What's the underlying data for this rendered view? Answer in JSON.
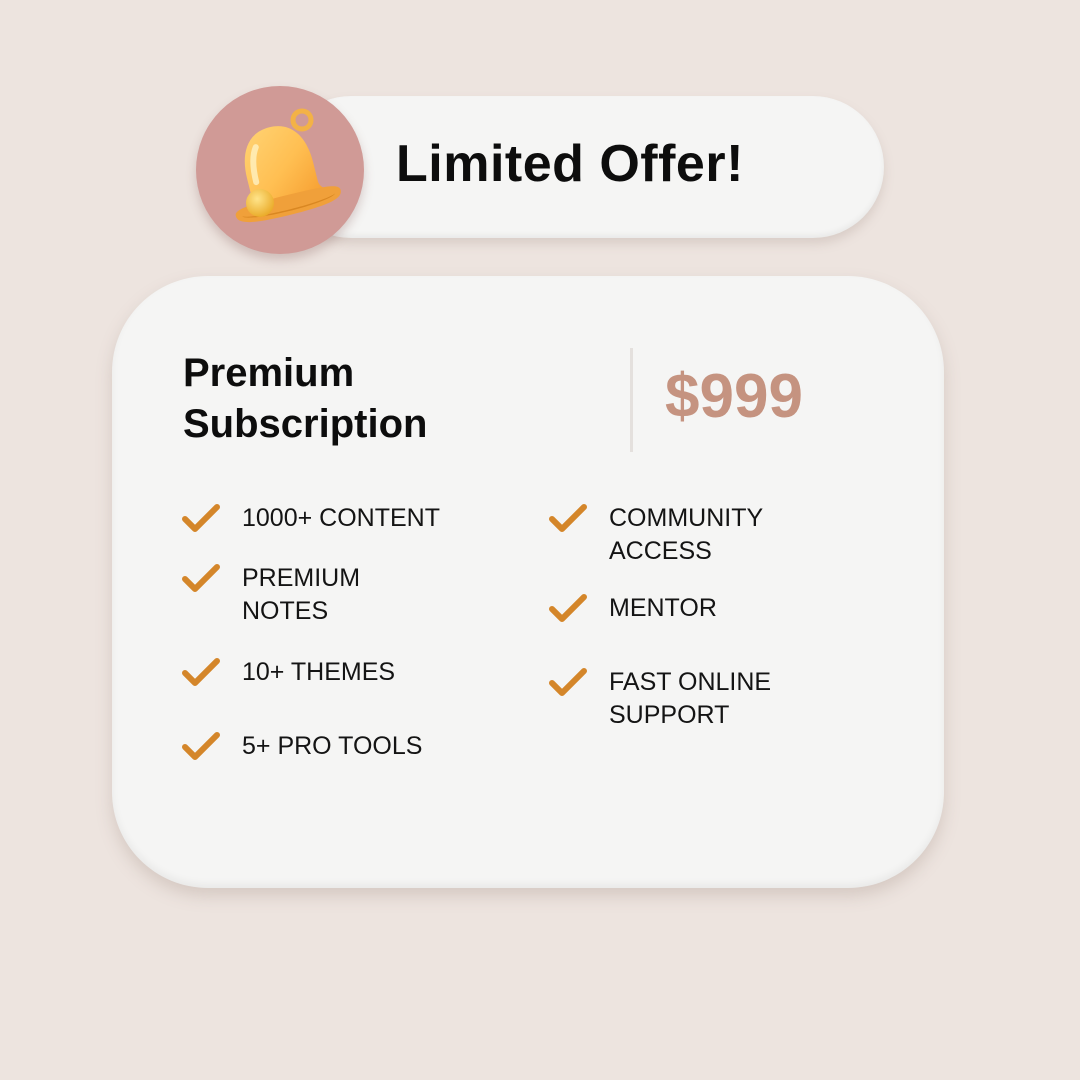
{
  "banner": {
    "title": "Limited Offer!"
  },
  "plan": {
    "name": "Premium Subscription",
    "price": "$999"
  },
  "features": {
    "left": [
      "1000+ CONTENT",
      "PREMIUM\nNOTES",
      "10+ THEMES",
      "5+ PRO TOOLS"
    ],
    "right": [
      "COMMUNITY\nACCESS",
      "MENTOR",
      "FAST ONLINE\nSUPPORT"
    ]
  },
  "icons": {
    "banner": "bell-icon",
    "feature": "check-icon"
  },
  "colors": {
    "background": "#ede4df",
    "bell_circle": "#d09a96",
    "price": "#c59380",
    "check": "#d4862a"
  }
}
